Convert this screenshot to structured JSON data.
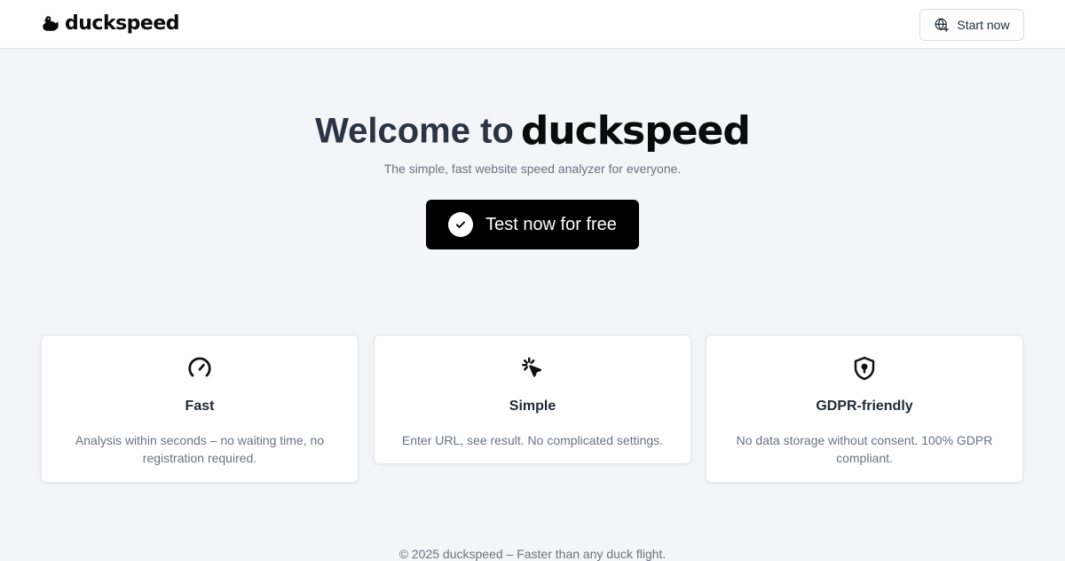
{
  "header": {
    "brand_name": "duckspeed",
    "start_label": "Start now"
  },
  "hero": {
    "title_prefix": "Welcome to",
    "title_brand": "duckspeed",
    "subtitle": "The simple, fast website speed analyzer for everyone.",
    "cta_label": "Test now for free"
  },
  "features": [
    {
      "icon": "speedometer-icon",
      "title": "Fast",
      "text": "Analysis within seconds – no waiting time, no registration required."
    },
    {
      "icon": "click-pointer-icon",
      "title": "Simple",
      "text": "Enter URL, see result. No complicated settings."
    },
    {
      "icon": "shield-lock-icon",
      "title": "GDPR-friendly",
      "text": "No data storage without consent. 100% GDPR compliant."
    }
  ],
  "footer": {
    "text": "© 2025 duckspeed – Faster than any duck flight."
  },
  "colors": {
    "background": "#f3f5f8",
    "cta": "#000000",
    "heading": "#2b3443",
    "muted": "#6b7280"
  }
}
